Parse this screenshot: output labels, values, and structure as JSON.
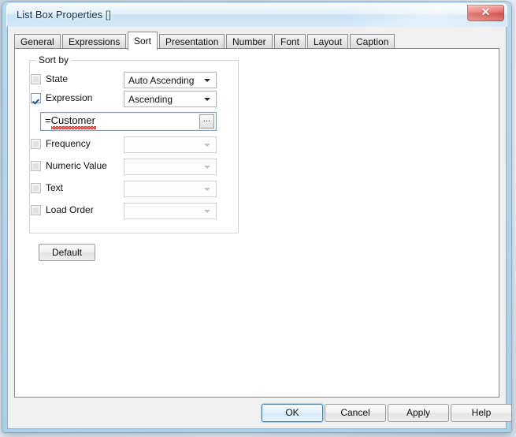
{
  "window": {
    "title": "List Box Properties",
    "title_brackets": "[]",
    "close_glyph": "✕"
  },
  "tabs": [
    {
      "label": "General",
      "active": false
    },
    {
      "label": "Expressions",
      "active": false
    },
    {
      "label": "Sort",
      "active": true
    },
    {
      "label": "Presentation",
      "active": false
    },
    {
      "label": "Number",
      "active": false
    },
    {
      "label": "Font",
      "active": false
    },
    {
      "label": "Layout",
      "active": false
    },
    {
      "label": "Caption",
      "active": false
    }
  ],
  "sort_group": {
    "legend": "Sort by",
    "rows": [
      {
        "label": "State",
        "checked": false,
        "enabled": true,
        "combo_value": "Auto Ascending",
        "combo_enabled": true
      },
      {
        "label": "Expression",
        "checked": true,
        "enabled": true,
        "combo_value": "Ascending",
        "combo_enabled": true
      },
      {
        "label": "Frequency",
        "checked": false,
        "enabled": true,
        "combo_value": "",
        "combo_enabled": false
      },
      {
        "label": "Numeric Value",
        "checked": false,
        "enabled": true,
        "combo_value": "",
        "combo_enabled": false
      },
      {
        "label": "Text",
        "checked": false,
        "enabled": true,
        "combo_value": "",
        "combo_enabled": false
      },
      {
        "label": "Load Order",
        "checked": false,
        "enabled": true,
        "combo_value": "",
        "combo_enabled": false
      }
    ],
    "expression": {
      "value": "=Customer",
      "ellipsis_label": "...",
      "misspelled": true
    }
  },
  "default_button": {
    "label": "Default"
  },
  "footer_buttons": [
    {
      "label": "OK",
      "focused": true
    },
    {
      "label": "Cancel",
      "focused": false
    },
    {
      "label": "Apply",
      "focused": false
    },
    {
      "label": "Help",
      "focused": false
    }
  ],
  "colors": {
    "accent": "#3c7fb1",
    "close_red": "#c6332c",
    "checkmark": "#21559b",
    "spell_error": "#dd1111",
    "title_bracket": "#2e6b4f"
  }
}
